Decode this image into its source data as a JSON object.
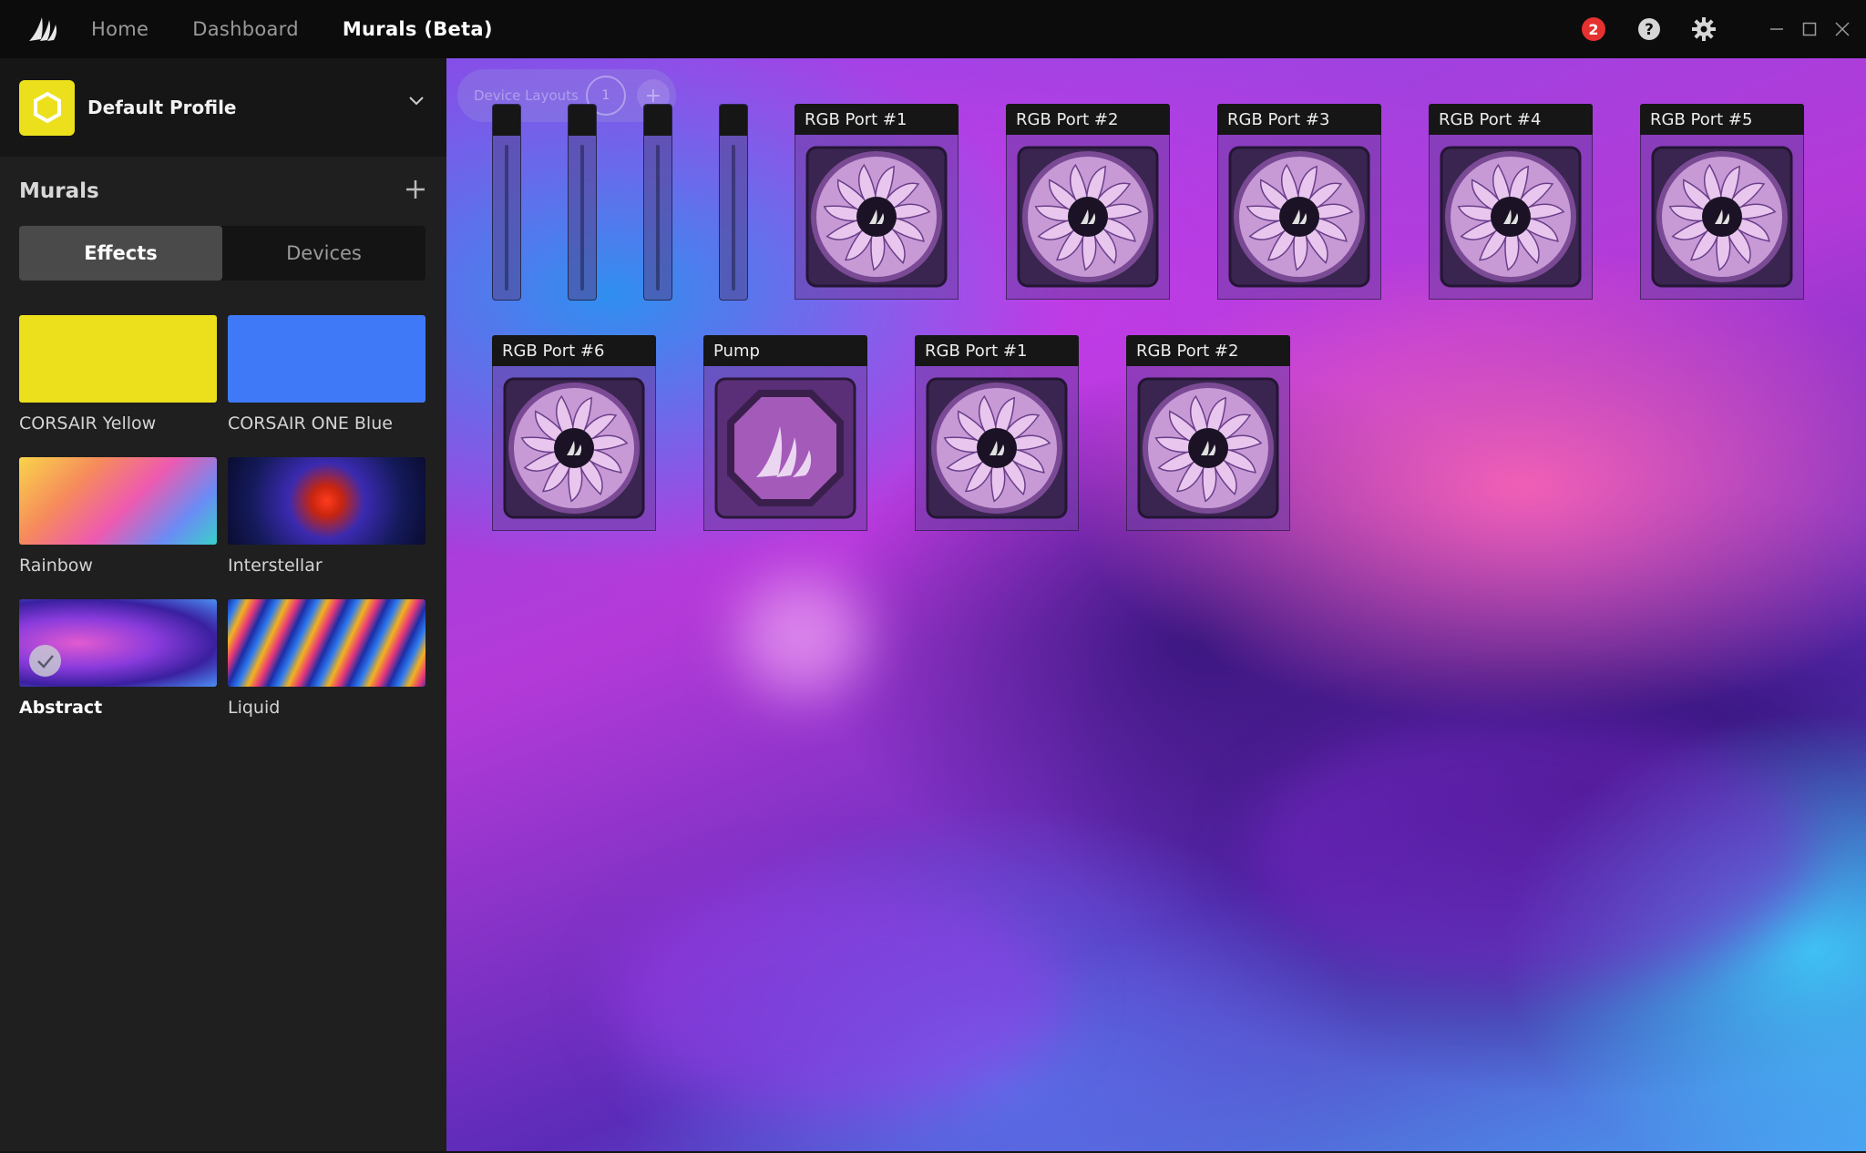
{
  "nav": {
    "home": "Home",
    "dashboard": "Dashboard",
    "murals": "Murals (Beta)"
  },
  "titlebar": {
    "notification_count": "2"
  },
  "profile": {
    "name": "Default Profile"
  },
  "sidebar": {
    "title": "Murals",
    "tabs": [
      {
        "label": "Effects",
        "active": true
      },
      {
        "label": "Devices",
        "active": false
      }
    ],
    "effects": [
      {
        "label": "CORSAIR Yellow",
        "color": "#ece01c"
      },
      {
        "label": "CORSAIR ONE Blue",
        "color": "#3f79f7"
      },
      {
        "label": "Rainbow"
      },
      {
        "label": "Interstellar"
      },
      {
        "label": "Abstract",
        "selected": true
      },
      {
        "label": "Liquid"
      }
    ]
  },
  "canvas": {
    "device_layouts_label": "Device Layouts",
    "device_layouts_count": "1",
    "devices": [
      {
        "label": "RGB Port #1",
        "type": "fan"
      },
      {
        "label": "RGB Port #2",
        "type": "fan"
      },
      {
        "label": "RGB Port #3",
        "type": "fan"
      },
      {
        "label": "RGB Port #4",
        "type": "fan"
      },
      {
        "label": "RGB Port #5",
        "type": "fan"
      },
      {
        "label": "RGB Port #6",
        "type": "fan"
      },
      {
        "label": "Pump",
        "type": "pump"
      },
      {
        "label": "RGB Port #1",
        "type": "fan"
      },
      {
        "label": "RGB Port #2",
        "type": "fan"
      }
    ]
  }
}
